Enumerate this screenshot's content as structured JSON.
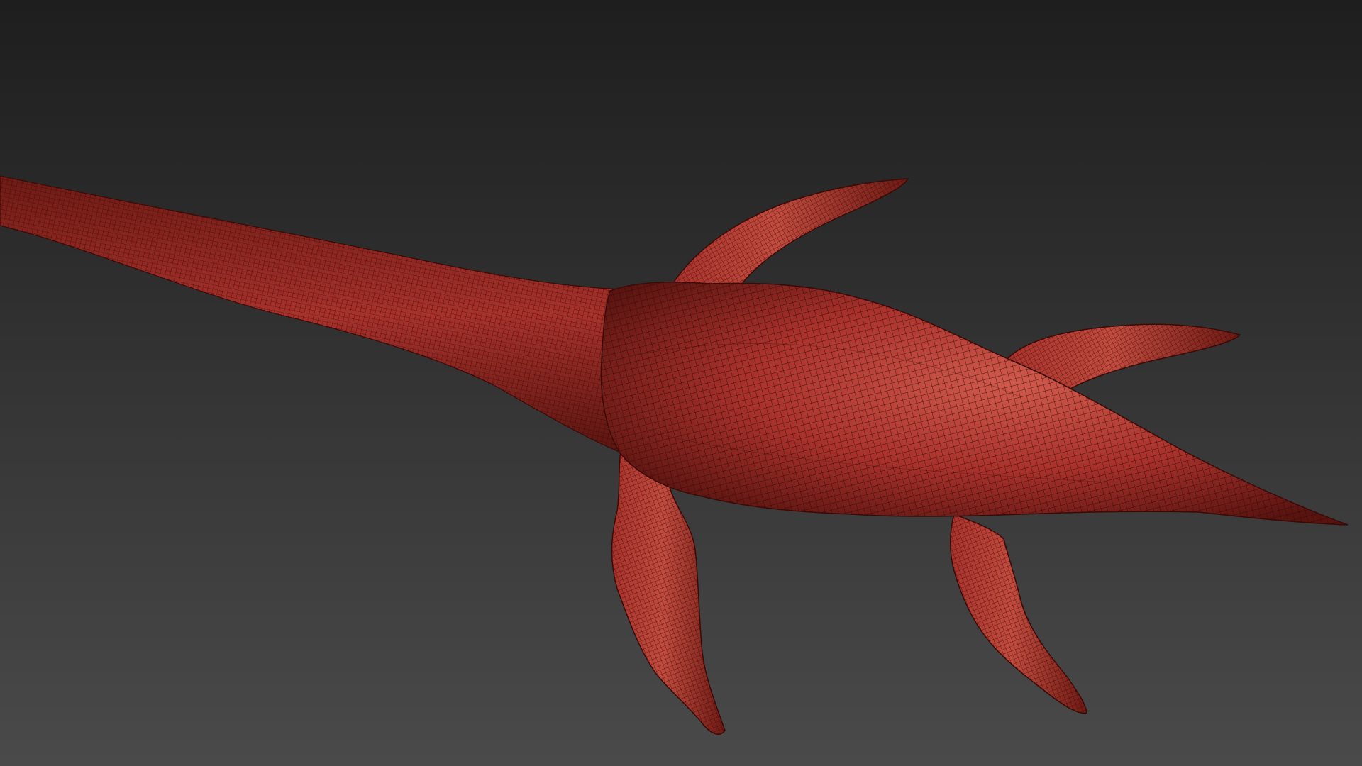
{
  "viewport": {
    "background_top": "#1e1e1e",
    "background_bottom": "#4a4a4a"
  },
  "model": {
    "subject": "plesiosaur-wireframe-model",
    "base_color": "#a8312b",
    "highlight_color": "#cf5a4c",
    "shadow_color": "#5a1410",
    "wire_color": "#2a0605"
  }
}
